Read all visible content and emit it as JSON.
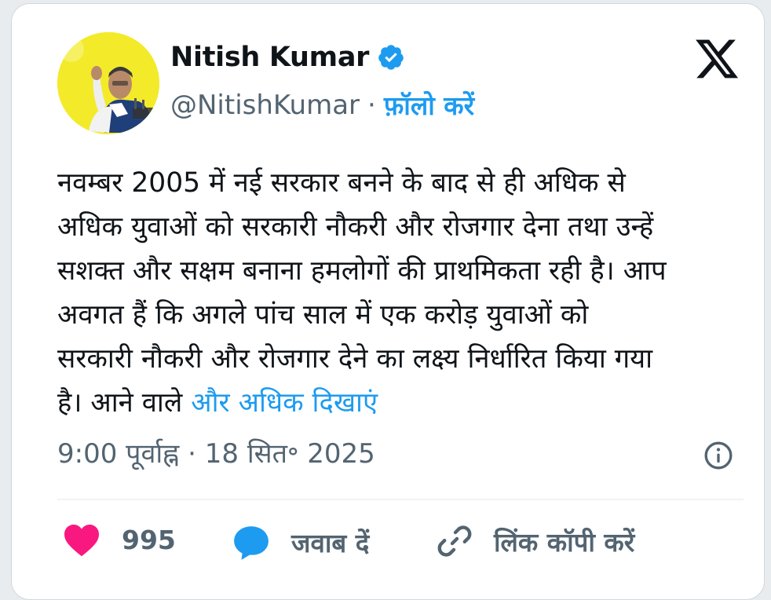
{
  "author": {
    "name": "Nitish Kumar",
    "handle": "@NitishKumar",
    "separator": "·",
    "follow_label": "फ़ॉलो करें",
    "verified": true
  },
  "platform_icon": "x-logo-icon",
  "tweet": {
    "lines": [
      "नवम्बर 2005 में नई सरकार बनने के बाद से ही अधिक से",
      "अधिक युवाओं को सरकारी नौकरी और रोजगार देना तथा उन्हें",
      "सशक्त और सक्षम बनाना हमलोगों की प्राथमिकता रही है। आप",
      "अवगत हैं कि अगले पांच साल में एक करोड़ युवाओं को",
      "सरकारी नौकरी और रोजगार देने का लक्ष्य निर्धारित किया गया"
    ],
    "last_line_prefix": "है। आने वाले ",
    "show_more_label": "और अधिक दिखाएं",
    "timestamp": "9:00 पूर्वाह्न · 18 सित॰ 2025"
  },
  "actions": {
    "likes_count": "995",
    "reply_label": "जवाब दें",
    "copy_link_label": "लिंक कॉपी करें"
  },
  "colors": {
    "accent": "#1d9bf0",
    "like": "#f91880",
    "text": "#0f1419",
    "muted": "#536471",
    "avatar_bg": "#f3ea2a"
  }
}
